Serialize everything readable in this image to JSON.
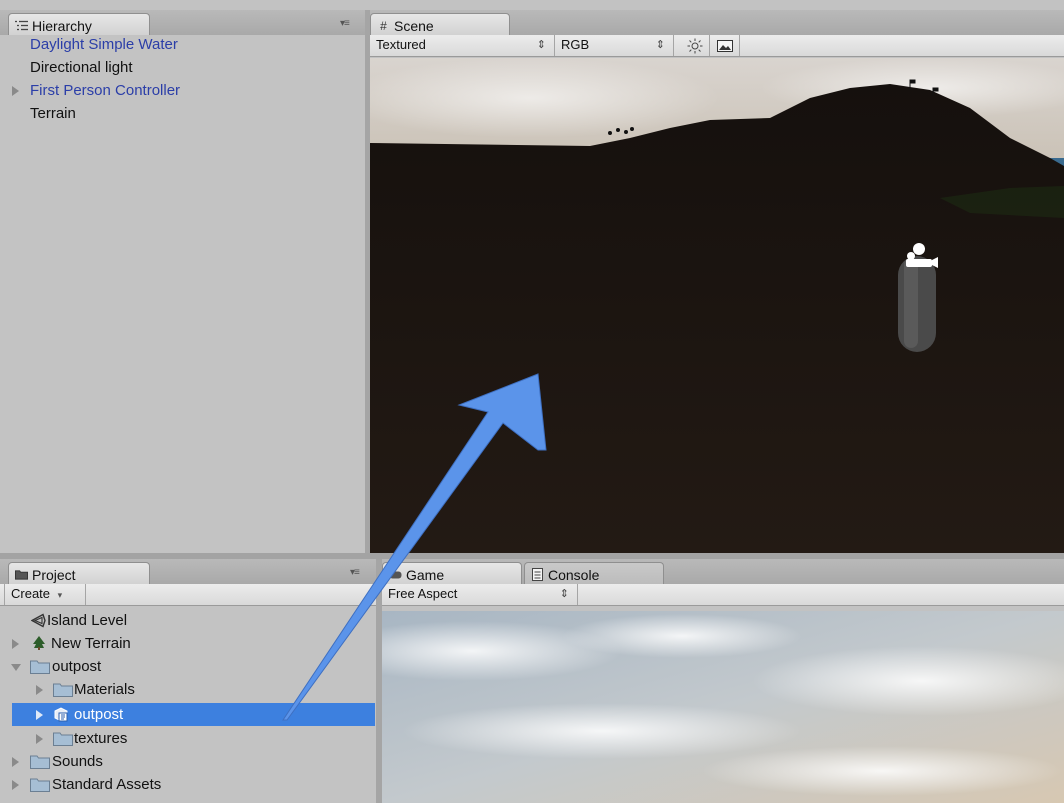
{
  "hierarchy": {
    "tab_label": "Hierarchy",
    "items": [
      {
        "label": "Daylight Simple Water",
        "prefab": true,
        "has_children": false
      },
      {
        "label": "Directional light",
        "prefab": false,
        "has_children": false
      },
      {
        "label": "First Person Controller",
        "prefab": true,
        "has_children": true
      },
      {
        "label": "Terrain",
        "prefab": false,
        "has_children": false
      }
    ]
  },
  "scene": {
    "tab_label": "Scene",
    "render_mode": "Textured",
    "color_mode": "RGB",
    "lighting_icon": "sun-icon",
    "effects_icon": "image-icon"
  },
  "project": {
    "tab_label": "Project",
    "create_label": "Create",
    "items": [
      {
        "label": "Island Level",
        "icon": "unity-scene-icon",
        "depth": 0,
        "foldout": "none"
      },
      {
        "label": "New Terrain",
        "icon": "terrain-icon",
        "depth": 0,
        "foldout": "closed"
      },
      {
        "label": "outpost",
        "icon": "folder-icon",
        "depth": 0,
        "foldout": "open"
      },
      {
        "label": "Materials",
        "icon": "folder-icon",
        "depth": 1,
        "foldout": "closed"
      },
      {
        "label": "outpost",
        "icon": "model-prefab-icon",
        "depth": 1,
        "foldout": "closed",
        "selected": true
      },
      {
        "label": "textures",
        "icon": "folder-icon",
        "depth": 1,
        "foldout": "closed"
      },
      {
        "label": "Sounds",
        "icon": "folder-icon",
        "depth": 0,
        "foldout": "closed"
      },
      {
        "label": "Standard Assets",
        "icon": "folder-icon",
        "depth": 0,
        "foldout": "closed"
      }
    ]
  },
  "game": {
    "tab_label": "Game",
    "aspect": "Free Aspect"
  },
  "console": {
    "tab_label": "Console"
  },
  "colors": {
    "selection": "#3d80df",
    "prefab_text": "#2b3ea8",
    "annotation_arrow": "#5b94ea"
  }
}
